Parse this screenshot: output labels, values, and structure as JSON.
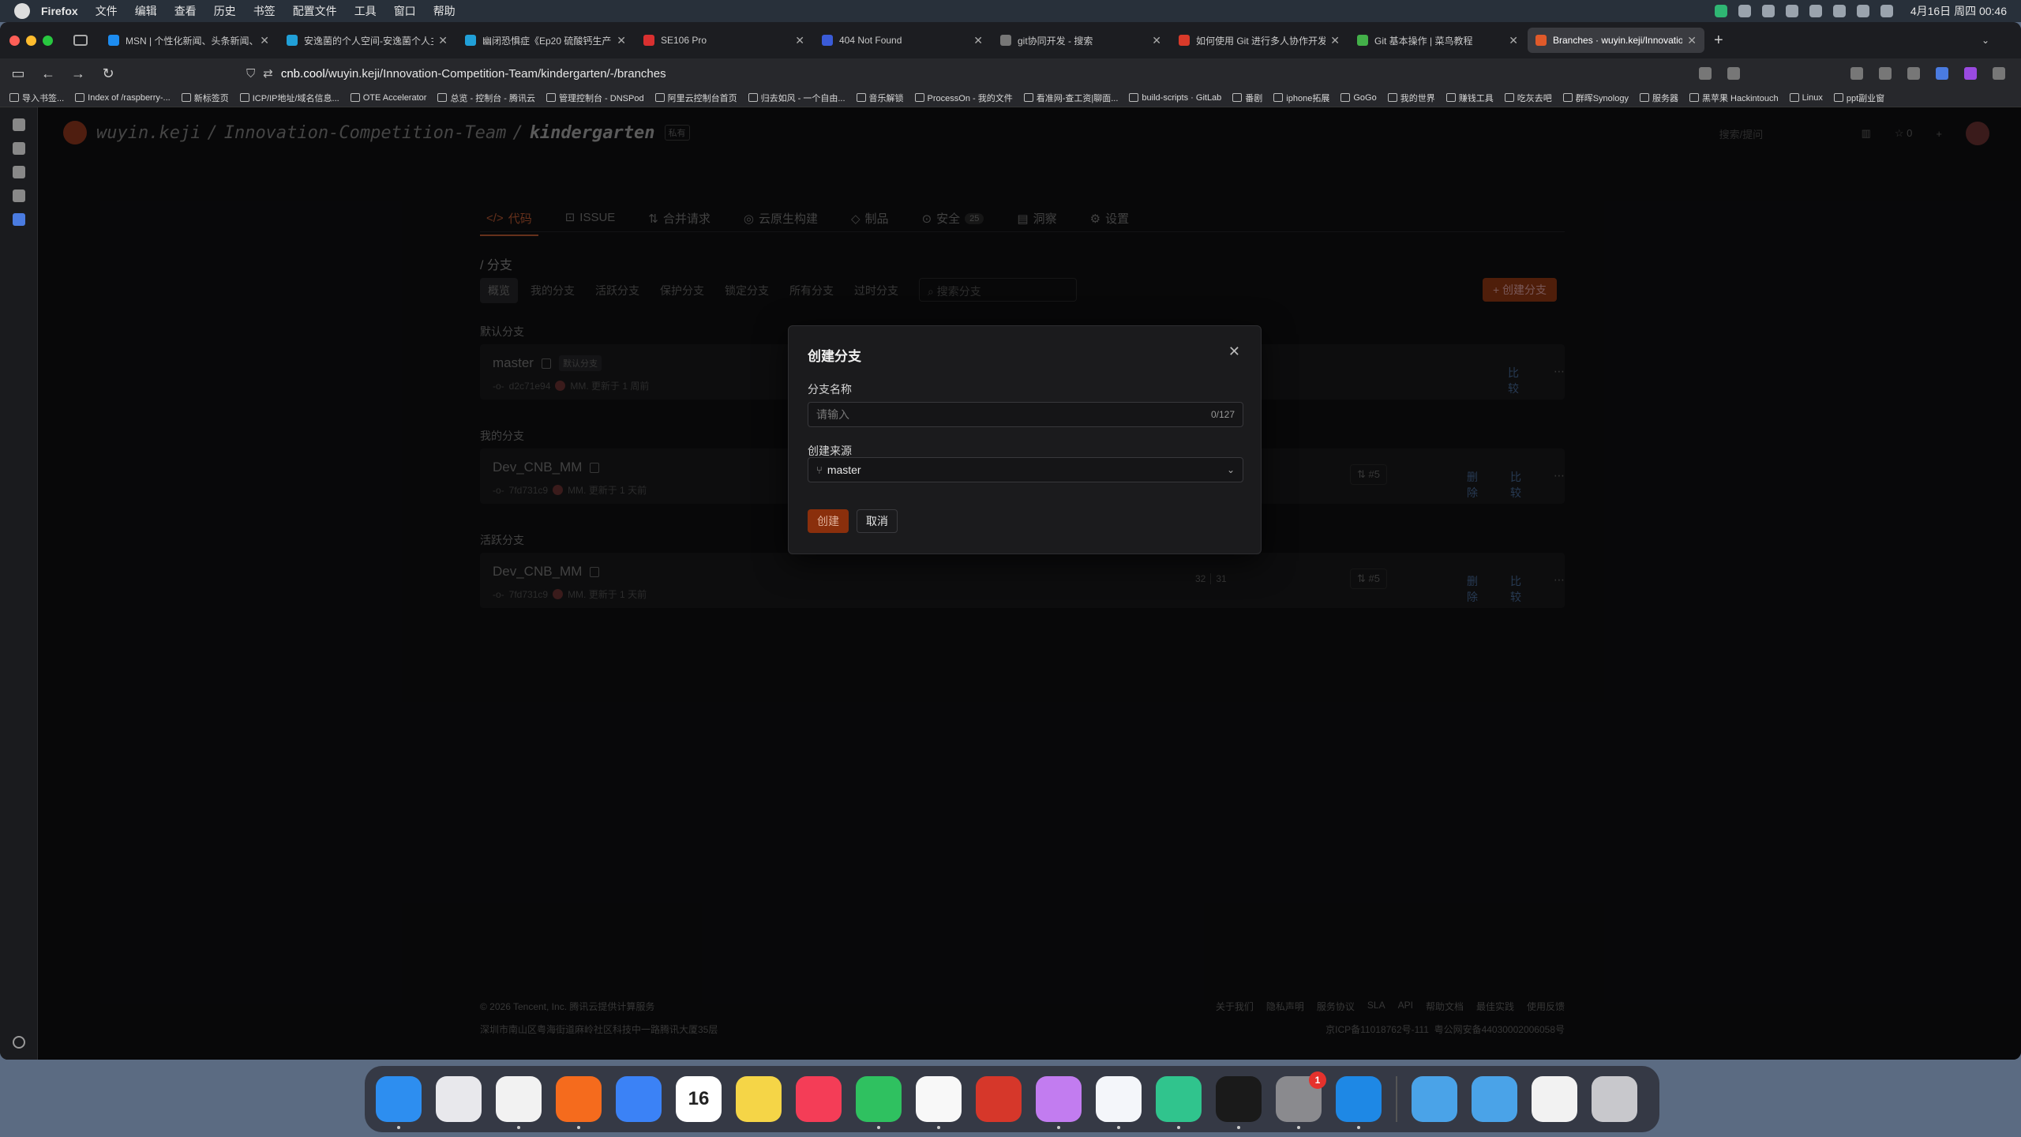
{
  "menubar": {
    "app": "Firefox",
    "items": [
      "文件",
      "编辑",
      "查看",
      "历史",
      "书签",
      "配置文件",
      "工具",
      "窗口",
      "帮助"
    ],
    "clock": "4月16日 周四 00:46"
  },
  "tabs": [
    {
      "title": "MSN | 个性化新闻、头条新闻、实",
      "color": "#1d8cf0"
    },
    {
      "title": "安逸菌的个人空间-安逸菌个人主页",
      "color": "#21a0d8"
    },
    {
      "title": "幽闭恐惧症《Ep20 硫酸钙生产",
      "color": "#21a0d8"
    },
    {
      "title": "SE106 Pro",
      "color": "#d93030"
    },
    {
      "title": "404 Not Found",
      "color": "#3a5bd8"
    },
    {
      "title": "git协同开发 - 搜索",
      "color": "#777777"
    },
    {
      "title": "如何使用 Git 进行多人协作开发",
      "color": "#d93a2a"
    },
    {
      "title": "Git 基本操作 | 菜鸟教程",
      "color": "#43b049"
    },
    {
      "title": "Branches · wuyin.keji/Innovation",
      "color": "#e05a2a"
    }
  ],
  "url": {
    "domain": "cnb.cool",
    "path": "/wuyin.keji/Innovation-Competition-Team/kindergarten/-/branches"
  },
  "bookmarks": [
    "导入书签...",
    "Index of /raspberry-...",
    "新标签页",
    "ICP/IP地址/域名信息...",
    "OTE Accelerator",
    "总览 - 控制台 - 腾讯云",
    "管理控制台 - DNSPod",
    "阿里云控制台首页",
    "归去如风 - 一个自由...",
    "音乐解锁",
    "ProcessOn - 我的文件",
    "看准网-查工资|聊面...",
    "build-scripts · GitLab",
    "番剧",
    "iphone拓展",
    "GoGo",
    "我的世界",
    "赚钱工具",
    "吃灰去吧",
    "群晖Synology",
    "服务器",
    "黑苹果 Hackintouch",
    "Linux",
    "ppt副业窗"
  ],
  "header": {
    "owner": "wuyin.keji",
    "team": "Innovation-Competition-Team",
    "repo": "kindergarten",
    "private": "私有",
    "search": "搜索/提问",
    "star": "0"
  },
  "nav_tabs": [
    {
      "label": "代码",
      "icon": "</>"
    },
    {
      "label": "ISSUE",
      "icon": "⊡"
    },
    {
      "label": "合并请求",
      "icon": "⇅"
    },
    {
      "label": "云原生构建",
      "icon": "◎"
    },
    {
      "label": "制品",
      "icon": "◇"
    },
    {
      "label": "安全",
      "icon": "⊙",
      "count": "25"
    },
    {
      "label": "洞察",
      "icon": "▤"
    },
    {
      "label": "设置",
      "icon": "⚙"
    }
  ],
  "breadcrumb": "/ 分支",
  "filters": [
    "概览",
    "我的分支",
    "活跃分支",
    "保护分支",
    "锁定分支",
    "所有分支",
    "过时分支"
  ],
  "branch_search": "搜索分支",
  "create_branch": "+ 创建分支",
  "sections": {
    "default": {
      "title": "默认分支",
      "name": "master",
      "tag": "默认分支",
      "hash": "d2c71e94",
      "meta": "MM. 更新于 1 周前",
      "compare": "比较"
    },
    "mine": {
      "title": "我的分支",
      "name": "Dev_CNB_MM",
      "hash": "7fd731c9",
      "meta": "MM. 更新于 1 天前",
      "pr": "#5",
      "delete": "删除",
      "compare": "比较"
    },
    "active": {
      "title": "活跃分支",
      "name": "Dev_CNB_MM",
      "hash": "7fd731c9",
      "meta": "MM. 更新于 1 天前",
      "ahead": "32",
      "behind": "31",
      "pr": "#5",
      "delete": "删除",
      "compare": "比较"
    }
  },
  "modal": {
    "title": "创建分支",
    "name_label": "分支名称",
    "name_placeholder": "请输入",
    "name_counter": "0/127",
    "source_label": "创建来源",
    "source_value": "master",
    "create": "创建",
    "cancel": "取消"
  },
  "footer": {
    "copyright": "© 2026 Tencent, Inc. 腾讯云提供计算服务",
    "address": "深圳市南山区粤海街道麻岭社区科技中一路腾讯大厦35层",
    "links": [
      "关于我们",
      "隐私声明",
      "服务协议",
      "SLA",
      "API",
      "帮助文档",
      "最佳实践",
      "使用反馈"
    ],
    "icp": "京ICP备11018762号-111",
    "police": "粤公网安备44030002006058号"
  },
  "dock": [
    {
      "name": "Finder",
      "color": "#2d8ef0",
      "running": true
    },
    {
      "name": "Launchpad",
      "color": "#e8e8ec"
    },
    {
      "name": "Chrome",
      "color": "#f2f2f2",
      "running": true
    },
    {
      "name": "Firefox",
      "color": "#f56b1d",
      "running": true
    },
    {
      "name": "iPhone Mirroring",
      "color": "#3b82f6"
    },
    {
      "name": "Calendar",
      "color": "#ffffff",
      "text": "16"
    },
    {
      "name": "Notes",
      "color": "#f5d547"
    },
    {
      "name": "Music",
      "color": "#f43d57"
    },
    {
      "name": "WeChat",
      "color": "#2fc160",
      "running": true
    },
    {
      "name": "QQ",
      "color": "#f8f8f8",
      "running": true
    },
    {
      "name": "Office",
      "color": "#d6372a"
    },
    {
      "name": "Cat",
      "color": "#c27cf0",
      "running": true
    },
    {
      "name": "Lark",
      "color": "#f4f6fa",
      "running": true
    },
    {
      "name": "Bot",
      "color": "#30c48d",
      "running": true
    },
    {
      "name": "Ascend",
      "color": "#1a1a1a",
      "running": true
    },
    {
      "name": "System Settings",
      "color": "#8a8a8e",
      "badge": "1",
      "running": true
    },
    {
      "name": "VS Code",
      "color": "#1e88e5",
      "running": true
    },
    {
      "name": "Applications",
      "color": "#4aa3e8"
    },
    {
      "name": "Downloads",
      "color": "#4aa3e8"
    },
    {
      "name": "Preview",
      "color": "#f2f2f2"
    },
    {
      "name": "Trash",
      "color": "#c8c8cc"
    }
  ]
}
